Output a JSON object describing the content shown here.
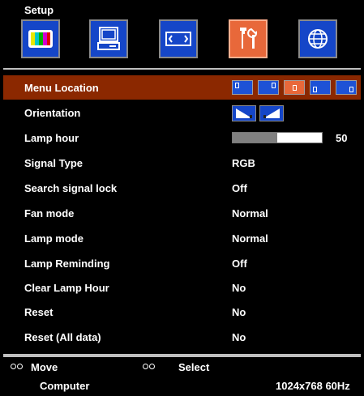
{
  "header": {
    "title": "Setup"
  },
  "tabs": [
    {
      "icon": "color-bars-icon"
    },
    {
      "icon": "computer-icon"
    },
    {
      "icon": "screen-aspect-icon"
    },
    {
      "icon": "tools-icon",
      "active": true
    },
    {
      "icon": "globe-icon"
    }
  ],
  "menu": {
    "menu_location": "Menu Location",
    "orientation": "Orientation",
    "lamp_hour": "Lamp hour",
    "lamp_hour_value": "50",
    "lamp_hour_level": 0.5,
    "signal_type": "Signal Type",
    "signal_type_value": "RGB",
    "search_signal_lock": "Search signal lock",
    "search_signal_lock_value": "Off",
    "fan_mode": "Fan mode",
    "fan_mode_value": "Normal",
    "lamp_mode": "Lamp mode",
    "lamp_mode_value": "Normal",
    "lamp_reminding": "Lamp Reminding",
    "lamp_reminding_value": "Off",
    "clear_lamp_hour": "Clear Lamp Hour",
    "clear_lamp_hour_value": "No",
    "reset": "Reset",
    "reset_value": "No",
    "reset_all": "Reset (All data)",
    "reset_all_value": "No"
  },
  "footer": {
    "move_label": "Move",
    "select_label": "Select",
    "source": "Computer",
    "resolution": "1024x768 60Hz"
  },
  "colors": {
    "selected_row": "#8b2800",
    "tab_blue": "#1546c8",
    "tab_active": "#e8683a"
  }
}
